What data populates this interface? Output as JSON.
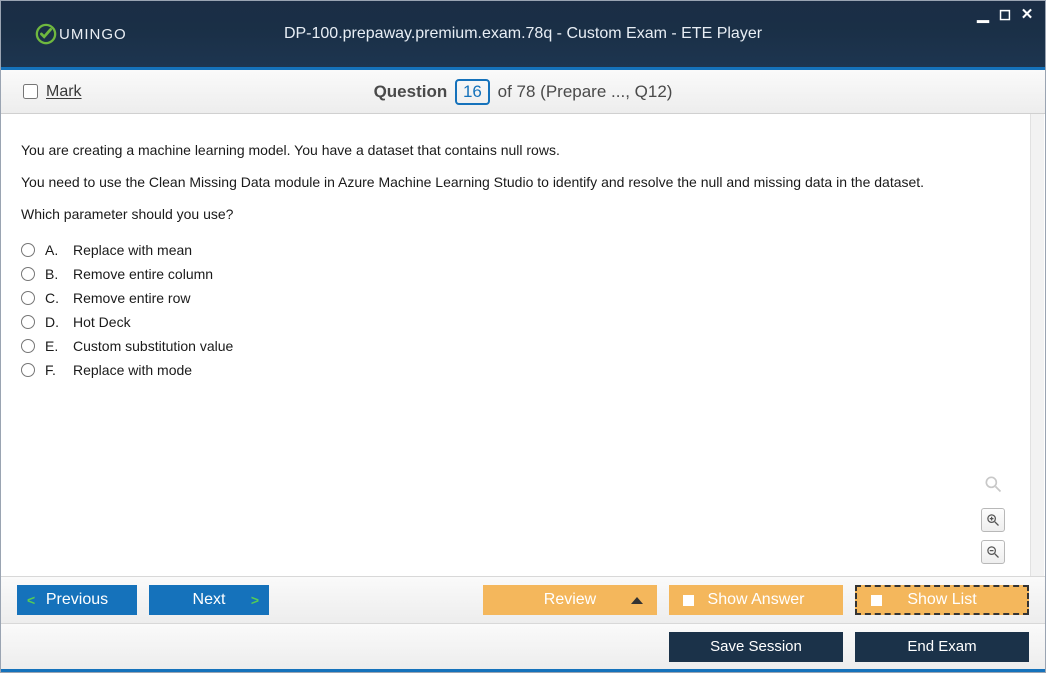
{
  "app": {
    "title": "DP-100.prepaway.premium.exam.78q - Custom Exam - ETE Player",
    "logo_text": "UMINGO"
  },
  "header": {
    "mark_label": "Mark",
    "question_word": "Question",
    "current_number": "16",
    "of_text": "of 78 (Prepare ..., Q12)"
  },
  "question": {
    "para1": "You are creating a machine learning model. You have a dataset that contains null rows.",
    "para2": "You need to use the Clean Missing Data module in Azure Machine Learning Studio to identify and resolve the null and missing data in the dataset.",
    "para3": "Which parameter should you use?",
    "options": [
      {
        "letter": "A.",
        "text": "Replace with mean"
      },
      {
        "letter": "B.",
        "text": "Remove entire column"
      },
      {
        "letter": "C.",
        "text": "Remove entire row"
      },
      {
        "letter": "D.",
        "text": "Hot Deck"
      },
      {
        "letter": "E.",
        "text": "Custom substitution value"
      },
      {
        "letter": "F.",
        "text": "Replace with mode"
      }
    ]
  },
  "toolbar": {
    "previous": "Previous",
    "next": "Next",
    "review": "Review",
    "show_answer": "Show Answer",
    "show_list": "Show List",
    "save_session": "Save Session",
    "end_exam": "End Exam"
  }
}
